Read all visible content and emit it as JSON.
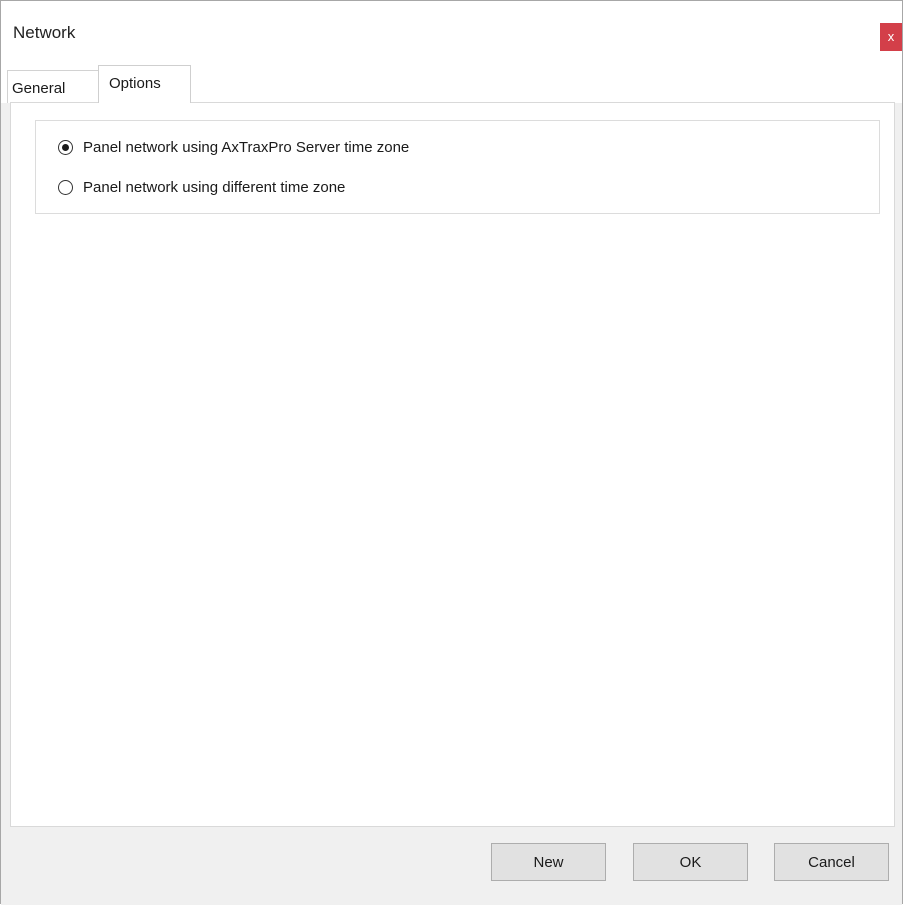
{
  "window": {
    "title": "Network",
    "close_label": "x"
  },
  "tabs": [
    {
      "label": "General",
      "selected": false
    },
    {
      "label": "Options",
      "selected": true
    }
  ],
  "options": {
    "radios": [
      {
        "label": "Panel network using AxTraxPro Server time zone",
        "checked": true
      },
      {
        "label": "Panel network using different time zone",
        "checked": false
      }
    ]
  },
  "buttons": {
    "new_label": "New",
    "ok_label": "OK",
    "cancel_label": "Cancel"
  },
  "colors": {
    "close_button": "#d33f49",
    "window_background": "#f0f0f0",
    "panel_background": "#ffffff"
  }
}
